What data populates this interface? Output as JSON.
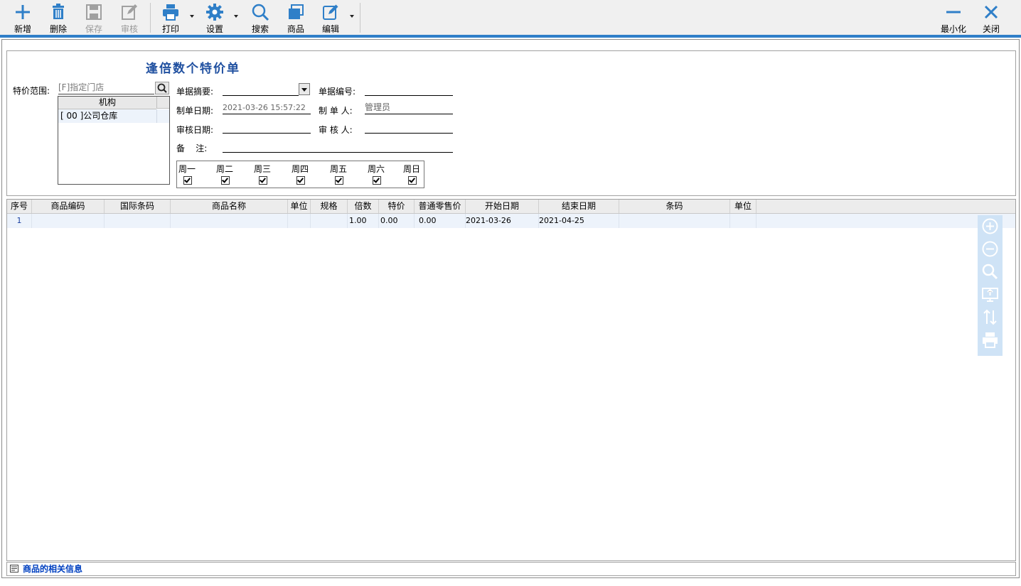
{
  "toolbar": {
    "new": "新增",
    "delete": "删除",
    "save": "保存",
    "review": "审核",
    "print": "打印",
    "settings": "设置",
    "search": "搜索",
    "goods": "商品",
    "edit": "编辑",
    "minimize": "最小化",
    "close": "关闭"
  },
  "colors": {
    "accent": "#2f7fc8",
    "title": "#2050a0",
    "row_bg": "#edf3fb",
    "side_tools": "#cfe3f6"
  },
  "form": {
    "title": "逢倍数个特价单",
    "scope_label": "特价范围:",
    "scope_placeholder": "[F]指定门店",
    "org_header": "机构",
    "org_rows": [
      "[ 00 ]公司仓库"
    ],
    "summary_label": "单据摘要:",
    "summary_value": "",
    "docno_label": "单据编号:",
    "docno_value": "",
    "make_date_label": "制单日期:",
    "make_date_value": "2021-03-26 15:57:22",
    "maker_label": "制 单 人:",
    "maker_value": "管理员",
    "review_date_label": "审核日期:",
    "review_date_value": "",
    "reviewer_label": "审 核 人:",
    "reviewer_value": "",
    "remark_label": "备    注:",
    "remark_value": "",
    "weekdays": [
      "周一",
      "周二",
      "周三",
      "周四",
      "周五",
      "周六",
      "周日"
    ],
    "weekdays_checked": [
      true,
      true,
      true,
      true,
      true,
      true,
      true
    ]
  },
  "grid": {
    "columns": [
      "序号",
      "商品编码",
      "国际条码",
      "商品名称",
      "单位",
      "规格",
      "倍数",
      "特价",
      "普通零售价",
      "开始日期",
      "结束日期",
      "条码",
      "单位"
    ],
    "rows": [
      [
        "1",
        "",
        "",
        "",
        "",
        "",
        "1.00",
        "0.00",
        "0.00",
        "2021-03-26",
        "2021-04-25",
        "",
        ""
      ]
    ]
  },
  "side_tools": [
    "zoom-in-icon",
    "zoom-out-icon",
    "search-icon",
    "screen-icon",
    "sort-icon",
    "printer-icon"
  ],
  "footer": {
    "text": "商品的相关信息"
  }
}
